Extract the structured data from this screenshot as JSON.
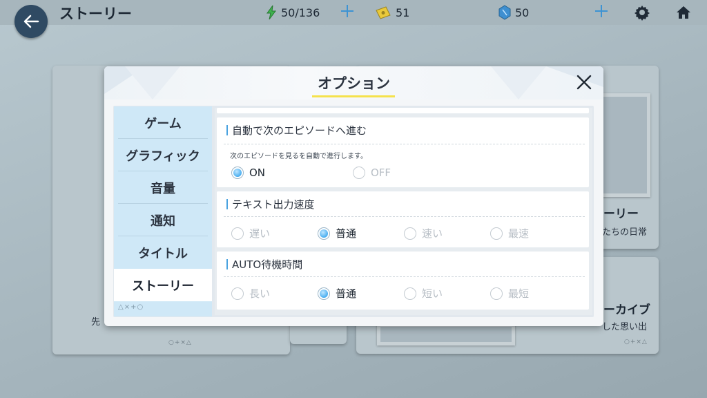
{
  "header": {
    "title": "ストーリー",
    "stamina": "50/136",
    "tickets": "51",
    "crystals": "50"
  },
  "background": {
    "card_right_top_caption": "ーリー",
    "card_right_top_sub": "たちの日常",
    "card_right_bottom_caption": "ーカイブ",
    "card_right_bottom_sub": "した思い出",
    "card_left_sub": "先",
    "card_symbols": "○+×△"
  },
  "modal": {
    "title": "オプション",
    "tabs": [
      {
        "label": "ゲーム"
      },
      {
        "label": "グラフィック"
      },
      {
        "label": "音量"
      },
      {
        "label": "通知"
      },
      {
        "label": "タイトル"
      },
      {
        "label": "ストーリー"
      }
    ],
    "active_tab": "ストーリー",
    "tab_deco": "△×+○",
    "settings": {
      "auto_next": {
        "label": "自動で次のエピソードへ進む",
        "description": "次のエピソードを見るを自動で進行します。",
        "options": [
          "ON",
          "OFF"
        ],
        "selected": "ON"
      },
      "text_speed": {
        "label": "テキスト出力速度",
        "options": [
          "遅い",
          "普通",
          "速い",
          "最速"
        ],
        "selected": "普通"
      },
      "auto_wait": {
        "label": "AUTO待機時間",
        "options": [
          "長い",
          "普通",
          "短い",
          "最短"
        ],
        "selected": "普通"
      }
    }
  },
  "colors": {
    "accent_blue": "#4aaef0",
    "title_underline": "#f5e24c",
    "back_button": "#2f4a63",
    "stamina_icon": "#3fb34f",
    "ticket_icon": "#e9c93a",
    "crystal_icon": "#3e8fd0"
  }
}
